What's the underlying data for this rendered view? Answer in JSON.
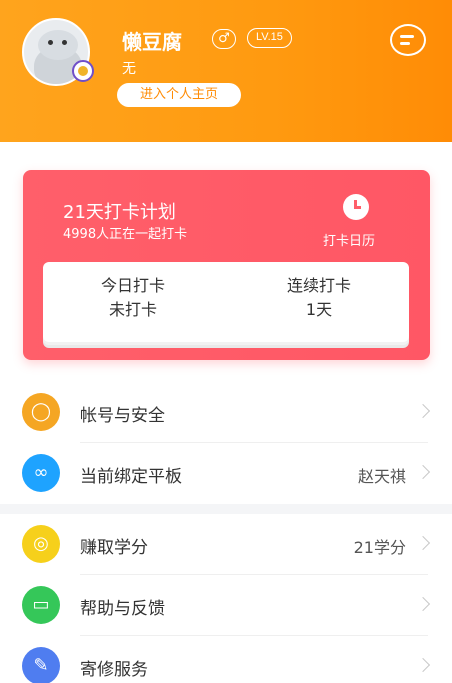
{
  "profile": {
    "nickname": "懒豆腐",
    "gender_symbol": "♂",
    "level": "LV.15",
    "signature": "无",
    "home_button": "进入个人主页"
  },
  "checkin": {
    "title": "21天打卡计划",
    "subtitle": "4998人正在一起打卡",
    "calendar_label": "打卡日历",
    "today_label": "今日打卡",
    "today_value": "未打卡",
    "streak_label": "连续打卡",
    "streak_value": "1天"
  },
  "menu": [
    {
      "label": "帐号与安全",
      "value": "",
      "icon": "user-shield-icon",
      "color": "#f5a623"
    },
    {
      "label": "当前绑定平板",
      "value": "赵天祺",
      "icon": "link-icon",
      "color": "#1ea3ff"
    },
    {
      "label": "赚取学分",
      "value": "21学分",
      "icon": "credit-icon",
      "color": "#f6d01b"
    },
    {
      "label": "帮助与反馈",
      "value": "",
      "icon": "chat-icon",
      "color": "#35c759"
    },
    {
      "label": "寄修服务",
      "value": "",
      "icon": "wrench-icon",
      "color": "#4f7df0"
    }
  ],
  "colors": {
    "header": "#ff9a10",
    "card": "#ff5f6a"
  }
}
